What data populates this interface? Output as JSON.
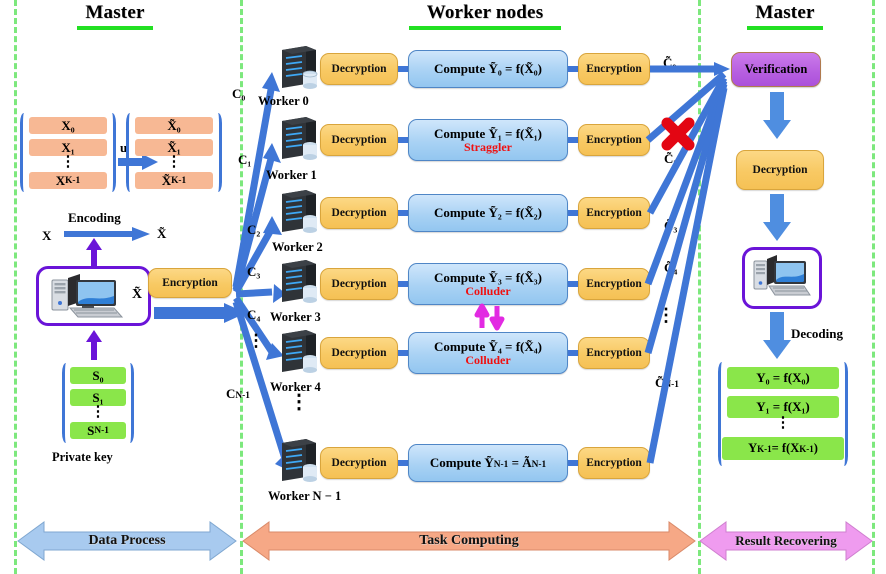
{
  "sections": [
    {
      "title": "Master",
      "underline_color": "#22e022"
    },
    {
      "title": "Worker nodes",
      "underline_color": "#22e022"
    },
    {
      "title": "Master",
      "underline_color": "#22e022"
    }
  ],
  "left_master": {
    "matrix_in": {
      "cells": [
        "X₀",
        "X₁",
        "X_{K-1}"
      ],
      "dots": "⋮",
      "color": "#f7b894"
    },
    "matrix_out": {
      "cells": [
        "X̃₀",
        "X̃₁",
        "X̃_{K-1}"
      ],
      "dots": "⋮",
      "color": "#f7b894"
    },
    "u_label": "u",
    "encoding": {
      "from": "X",
      "label": "Encoding",
      "to": "X̃"
    },
    "pc_label": "X̃",
    "encryption_label": "Encryption",
    "private_key": {
      "cells": [
        "S₀",
        "S₁",
        "S_{N-1}"
      ],
      "dots": "⋮",
      "caption": "Private key",
      "color": "#8ae64a"
    }
  },
  "channel_labels": [
    "C₀",
    "C₁",
    "C₂",
    "C₃",
    "C₄",
    "C_{N-1}"
  ],
  "workers": [
    {
      "name": "Worker 0",
      "decryption": "Decryption",
      "compute": "Compute Ỹ₀ = f(X̃₀)",
      "status": "",
      "encryption": "Encryption",
      "out": "C̃₀",
      "blocked": false
    },
    {
      "name": "Worker 1",
      "decryption": "Decryption",
      "compute": "Compute Ỹ₁ = f(X̃₁)",
      "status": "Straggler",
      "encryption": "Encryption",
      "out": "C̃₂",
      "blocked": true
    },
    {
      "name": "Worker 2",
      "decryption": "Decryption",
      "compute": "Compute Ỹ₂ = f(X̃₂)",
      "status": "",
      "encryption": "Encryption",
      "out": "C̃₃",
      "blocked": false
    },
    {
      "name": "Worker 3",
      "decryption": "Decryption",
      "compute": "Compute Ỹ₃ = f(X̃₃)",
      "status": "Colluder",
      "encryption": "Encryption",
      "out": "C̃₄",
      "blocked": false
    },
    {
      "name": "Worker 4",
      "decryption": "Decryption",
      "compute": "Compute Ỹ₄ = f(X̃₄)",
      "status": "Colluder",
      "encryption": "Encryption",
      "out": "",
      "blocked": false
    },
    {
      "name": "Worker N − 1",
      "decryption": "Decryption",
      "compute": "Compute Ỹ_{N-1} = Ã_{N-1}",
      "status": "",
      "encryption": "Encryption",
      "out": "C̃_{N-1}",
      "blocked": false
    }
  ],
  "worker_vdots": "⋮",
  "out_vdots": "⋮",
  "right_master": {
    "verification": "Verification",
    "decryption": "Decryption",
    "decoding": "Decoding",
    "results": {
      "cells": [
        "Y₀ = f(X₀)",
        "Y₁ = f(X₁)",
        "Y_{K-1} = f(X_{K-1})"
      ],
      "dots": "⋮",
      "color": "#8ae64a"
    }
  },
  "phases": [
    {
      "label": "Data Process",
      "color": "#a8caef"
    },
    {
      "label": "Task Computing",
      "color": "#f6a886"
    },
    {
      "label": "Result Recovering",
      "color": "#ef9bef"
    }
  ],
  "colors": {
    "divider": "#7de87d",
    "arrow_blue": "#3f76d6",
    "arrow_purple": "#6a14d8",
    "collude_magenta": "#e22ae2",
    "error_red": "#e30613",
    "amber": "#f8c963",
    "compute_blue": "#a9d2f4",
    "verify_purple": "#b65ee0"
  }
}
